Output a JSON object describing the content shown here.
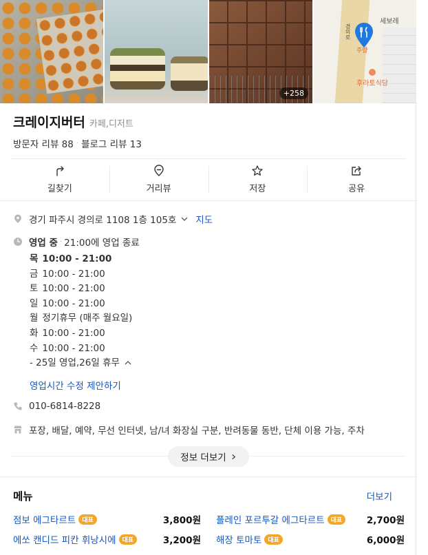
{
  "photos": {
    "more_count": "+258",
    "map_labels": [
      "세보레",
      "주량",
      "후라토식당",
      "경의로"
    ]
  },
  "place": {
    "name": "크레이지버터",
    "category": "카페,디저트",
    "visitor_reviews": "방문자 리뷰 88",
    "blog_reviews": "블로그 리뷰 13"
  },
  "actions": [
    {
      "label": "길찾기",
      "icon": "directions-icon"
    },
    {
      "label": "거리뷰",
      "icon": "street-view-icon"
    },
    {
      "label": "저장",
      "icon": "star-icon"
    },
    {
      "label": "공유",
      "icon": "share-icon"
    }
  ],
  "address": {
    "text": "경기 파주시 경의로 1108 1층 105호",
    "map_link": "지도"
  },
  "hours": {
    "status": "영업 중",
    "close_info": "21:00에 영업 종료",
    "days": [
      {
        "day": "목",
        "time": "10:00 - 21:00"
      },
      {
        "day": "금",
        "time": "10:00 - 21:00"
      },
      {
        "day": "토",
        "time": "10:00 - 21:00"
      },
      {
        "day": "일",
        "time": "10:00 - 21:00"
      },
      {
        "day": "월",
        "time": "정기휴무 (매주 월요일)"
      },
      {
        "day": "화",
        "time": "10:00 - 21:00"
      },
      {
        "day": "수",
        "time": "10:00 - 21:00"
      }
    ],
    "note": "- 25일 영업,26일 휴무",
    "edit_link": "영업시간 수정 제안하기"
  },
  "phone": "010-6814-8228",
  "amenities": "포장, 배달, 예약, 무선 인터넷, 남/녀 화장실 구분, 반려동물 동반, 단체 이용 가능, 주차",
  "more_info_label": "정보 더보기",
  "menu": {
    "title": "메뉴",
    "more": "더보기",
    "badge": "대표",
    "items": [
      {
        "name": "점보 에그타르트",
        "price": "3,800원"
      },
      {
        "name": "플레인 포르투갈 에그타르트",
        "price": "2,700원"
      },
      {
        "name": "에쏘 캔디드 피칸 휘낭시에",
        "price": "3,200원"
      },
      {
        "name": "해장 토마토",
        "price": "6,000원"
      }
    ]
  },
  "colors": {
    "link": "#1457c4",
    "badge": "#f3a72a",
    "map_pin": "#1e7ae0"
  }
}
